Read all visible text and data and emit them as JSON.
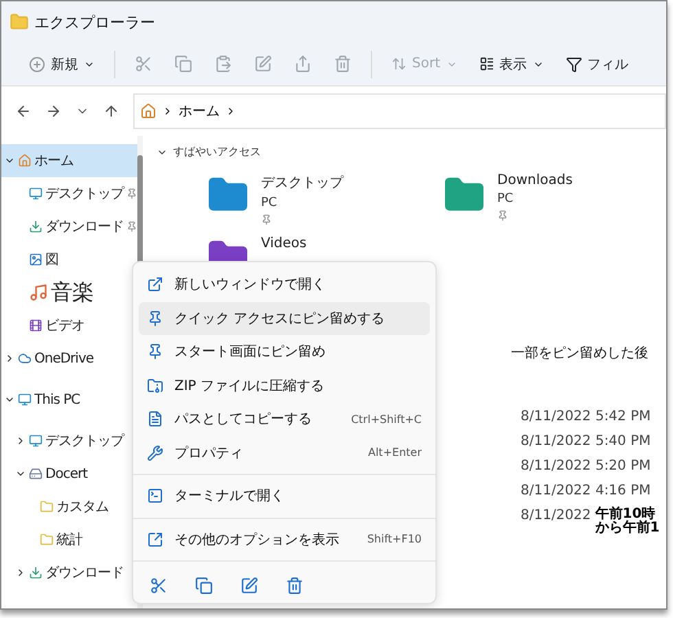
{
  "window": {
    "title": "エクスプローラー"
  },
  "toolbar": {
    "new": "新規",
    "sort": "Sort",
    "view": "表示",
    "filter": "フィル"
  },
  "address": {
    "crumbs": [
      "ホーム"
    ]
  },
  "sidebar": {
    "items": [
      {
        "label": "ホーム",
        "expanded": true,
        "selected": true,
        "pinned": false,
        "children": [
          {
            "label": "デスクトップ",
            "pinned": true,
            "selected": false
          },
          {
            "label": "ダウンロード",
            "pinned": true,
            "selected": false
          },
          {
            "label": "図",
            "pinned": false,
            "selected": false
          },
          {
            "label": "音楽",
            "pinned": false,
            "selected": false,
            "large": true
          },
          {
            "label": "ビデオ",
            "pinned": false,
            "selected": false
          }
        ]
      },
      {
        "label": "OneDrive",
        "expanded": false,
        "selected": false,
        "pinned": false
      },
      {
        "label": "This PC",
        "expanded": true,
        "selected": false,
        "pinned": false,
        "children": [
          {
            "label": "デスクトップ",
            "expanded": false,
            "selected": false,
            "pinned": false
          },
          {
            "label": "Docert",
            "expanded": true,
            "selected": false,
            "pinned": false,
            "children": [
              {
                "label": "カスタム",
                "selected": false,
                "pinned": false
              },
              {
                "label": "統計",
                "selected": false,
                "pinned": false
              }
            ]
          },
          {
            "label": "ダウンロード",
            "expanded": false,
            "selected": false,
            "pinned": false
          }
        ]
      }
    ]
  },
  "quick_access": {
    "title": "すばやいアクセス",
    "tiles": [
      {
        "name": "デスクトップ",
        "location": "PC",
        "pinned": true
      },
      {
        "name": "Downloads",
        "location": "PC",
        "pinned": true
      },
      {
        "name": "Videos"
      }
    ]
  },
  "annotation": "一部をピン留めした後",
  "dates": [
    {
      "text": "8/11/2022 5:42 PM"
    },
    {
      "text": "8/11/2022 5:40 PM"
    },
    {
      "text": "8/11/2022 5:20 PM"
    },
    {
      "text": "8/11/2022 4:16 PM"
    },
    {
      "text": "8/11/2022",
      "note": "午前10時から午前1"
    }
  ],
  "context_menu": {
    "groups": [
      [
        {
          "label": "新しいウィンドウで開く",
          "selected": false
        },
        {
          "label": "クイック アクセスにピン留めする",
          "selected": true
        },
        {
          "label": "スタート画面にピン留め",
          "selected": false
        },
        {
          "label": "ZIP ファイルに圧縮する",
          "selected": false
        },
        {
          "label": "パスとしてコピーする",
          "shortcut": "Ctrl+Shift+C",
          "selected": false
        },
        {
          "label": "プロパティ",
          "shortcut": "Alt+Enter",
          "selected": false
        }
      ],
      [
        {
          "label": "ターミナルで開く",
          "selected": false
        }
      ],
      [
        {
          "label": "その他のオプションを表示",
          "shortcut": "Shift+F10",
          "selected": false
        }
      ]
    ]
  }
}
